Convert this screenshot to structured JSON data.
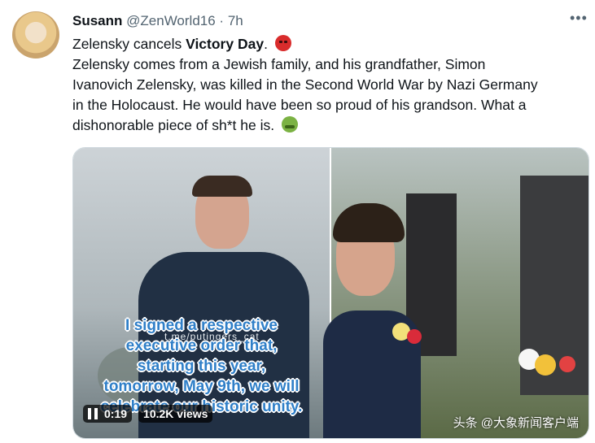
{
  "tweet": {
    "author_name": "Susann",
    "author_handle": "@ZenWorld16",
    "separator": "·",
    "time": "7h",
    "more_icon": "more-icon",
    "line1_prefix": "Zelensky cancels ",
    "line1_bold": "Victory Day",
    "line1_suffix": ".",
    "line2": "Zelensky comes from a Jewish family, and his grandfather, Simon",
    "line3": "Ivanovich Zelensky, was killed in the Second World War by Nazi Germany",
    "line4": "in the Holocaust. He would have been so proud of his grandson. What a",
    "line5": "dishonorable piece of sh*t he is.",
    "emoji_1": "angry-face-emoji",
    "emoji_2": "sick-face-emoji"
  },
  "media": {
    "video": {
      "video_watermark": "t.me/putingers_cat",
      "subtitles": [
        "I signed a respective",
        "executive order that,",
        "starting this year,",
        "tomorrow, May 9th, we will",
        "celebrate our historic unity."
      ],
      "time": "0:19",
      "views": "10.2K views"
    },
    "photo": {
      "caption": "头条 @大象新闻客户端"
    }
  }
}
